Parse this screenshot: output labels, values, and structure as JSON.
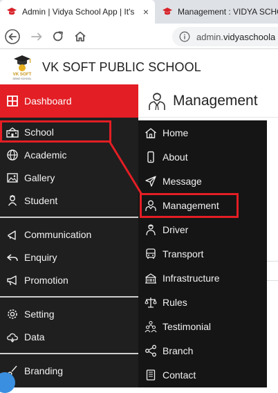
{
  "browser": {
    "tabs": [
      {
        "title": "Admin | Vidya School App | It's",
        "close": "×"
      },
      {
        "title": "Management : VIDYA SCHO"
      }
    ],
    "url": {
      "host_prefix": "admin.",
      "host_rest": "vidyaschoola"
    }
  },
  "app": {
    "logo_text": "VK SOFT",
    "logo_sub": "DEMO SCHOOL",
    "school_name": "VK SOFT PUBLIC SCHOOL"
  },
  "sidebar": {
    "dashboard": "Dashboard",
    "items": [
      {
        "label": "School",
        "icon": "school-icon"
      },
      {
        "label": "Academic",
        "icon": "globe-icon"
      },
      {
        "label": "Gallery",
        "icon": "image-icon"
      },
      {
        "label": "Student",
        "icon": "student-icon"
      },
      {
        "label": "Communication",
        "icon": "megaphone-icon"
      },
      {
        "label": "Enquiry",
        "icon": "reply-icon"
      },
      {
        "label": "Promotion",
        "icon": "bullhorn-icon"
      },
      {
        "label": "Setting",
        "icon": "gear-icon"
      },
      {
        "label": "Data",
        "icon": "cloud-icon"
      },
      {
        "label": "Branding",
        "icon": "brush-icon"
      }
    ]
  },
  "content": {
    "title": "Management"
  },
  "submenu": {
    "items": [
      {
        "label": "Home",
        "icon": "home-icon"
      },
      {
        "label": "About",
        "icon": "mobile-icon"
      },
      {
        "label": "Message",
        "icon": "send-icon"
      },
      {
        "label": "Management",
        "icon": "manager-icon"
      },
      {
        "label": "Driver",
        "icon": "driver-icon"
      },
      {
        "label": "Transport",
        "icon": "bus-icon"
      },
      {
        "label": "Infrastructure",
        "icon": "building-icon"
      },
      {
        "label": "Rules",
        "icon": "scales-icon"
      },
      {
        "label": "Testimonial",
        "icon": "people-icon"
      },
      {
        "label": "Branch",
        "icon": "share-icon"
      },
      {
        "label": "Contact",
        "icon": "phone-icon"
      }
    ]
  },
  "colors": {
    "accent": "#e31e24",
    "sidebar_bg": "#1f1f1f",
    "submenu_bg": "#151515"
  }
}
